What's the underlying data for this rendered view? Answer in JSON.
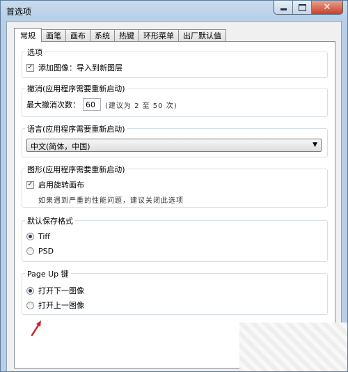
{
  "window": {
    "title": "首选项"
  },
  "tabs": [
    "常规",
    "画笔",
    "画布",
    "系统",
    "热键",
    "环形菜单",
    "出厂默认值"
  ],
  "options": {
    "legend": "选项",
    "checkbox_label": "添加图像：导入到新图层",
    "checked": true
  },
  "undo": {
    "legend": "撤消(应用程序需要重新启动)",
    "label": "最大撤消次数：",
    "value": "60",
    "hint": "(建议为 2 至 50 次)"
  },
  "language": {
    "legend": "语言(应用程序需要重新启动)",
    "selected": "中文(简体，中国)"
  },
  "graphics": {
    "legend": "图形(应用程序需要重新启动)",
    "checkbox_label": "启用旋转画布",
    "checked": true,
    "note": "如果遇到严重的性能问题，建议关闭此选项"
  },
  "save_format": {
    "legend": "默认保存格式",
    "options": [
      "Tiff",
      "PSD"
    ],
    "selected": "Tiff"
  },
  "pageup": {
    "legend": "Page Up 键",
    "options": [
      "打开下一图像",
      "打开上一图像"
    ],
    "selected": "打开下一图像"
  },
  "colors": {
    "accent_arrow": "#d32020",
    "title_bar": "#b8cfe8"
  }
}
